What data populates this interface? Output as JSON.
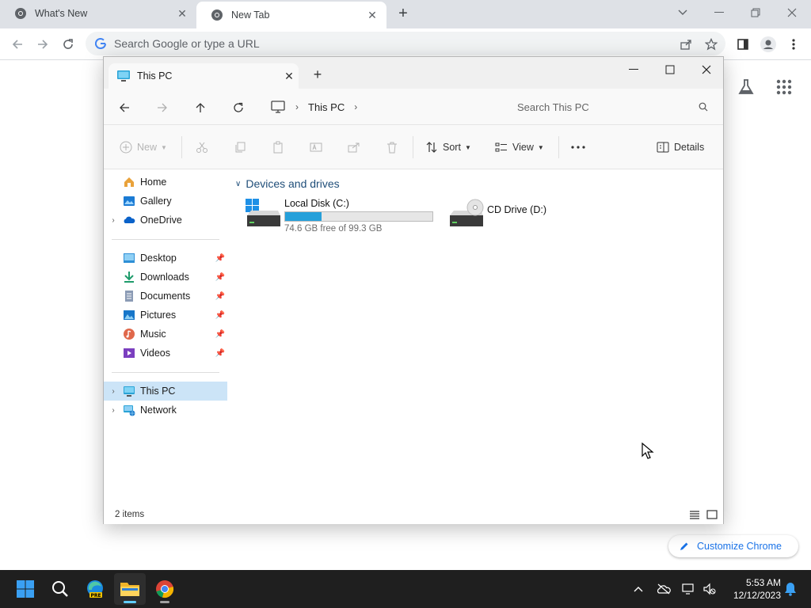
{
  "chrome": {
    "tabs": [
      {
        "title": "What's New",
        "icon": "chrome-favicon"
      },
      {
        "title": "New Tab",
        "icon": "chrome-favicon"
      }
    ],
    "omnibox_placeholder": "Search Google or type a URL",
    "customize_label": "Customize Chrome"
  },
  "explorer": {
    "tab_title": "This PC",
    "breadcrumb": [
      "This PC"
    ],
    "search_placeholder": "Search This PC",
    "commands": {
      "new": "New",
      "sort": "Sort",
      "view": "View",
      "details": "Details"
    },
    "sidebar": {
      "top": [
        {
          "label": "Home",
          "icon": "home-icon"
        },
        {
          "label": "Gallery",
          "icon": "gallery-icon"
        },
        {
          "label": "OneDrive",
          "icon": "onedrive-icon",
          "expandable": true
        }
      ],
      "pinned": [
        {
          "label": "Desktop",
          "icon": "desktop-icon"
        },
        {
          "label": "Downloads",
          "icon": "downloads-icon"
        },
        {
          "label": "Documents",
          "icon": "documents-icon"
        },
        {
          "label": "Pictures",
          "icon": "pictures-icon"
        },
        {
          "label": "Music",
          "icon": "music-icon"
        },
        {
          "label": "Videos",
          "icon": "videos-icon"
        }
      ],
      "bottom": [
        {
          "label": "This PC",
          "icon": "this-pc-icon",
          "selected": true
        },
        {
          "label": "Network",
          "icon": "network-icon"
        }
      ]
    },
    "group_header": "Devices and drives",
    "drives": [
      {
        "name": "Local Disk (C:)",
        "free_text": "74.6 GB free of 99.3 GB",
        "used_fraction": 0.249
      },
      {
        "name": "CD Drive (D:)"
      }
    ],
    "status": "2 items"
  },
  "taskbar": {
    "apps": [
      "start-icon",
      "search-icon",
      "edge-pre-icon",
      "file-explorer-icon",
      "chrome-icon"
    ],
    "time": "5:53 AM",
    "date": "12/12/2023"
  }
}
